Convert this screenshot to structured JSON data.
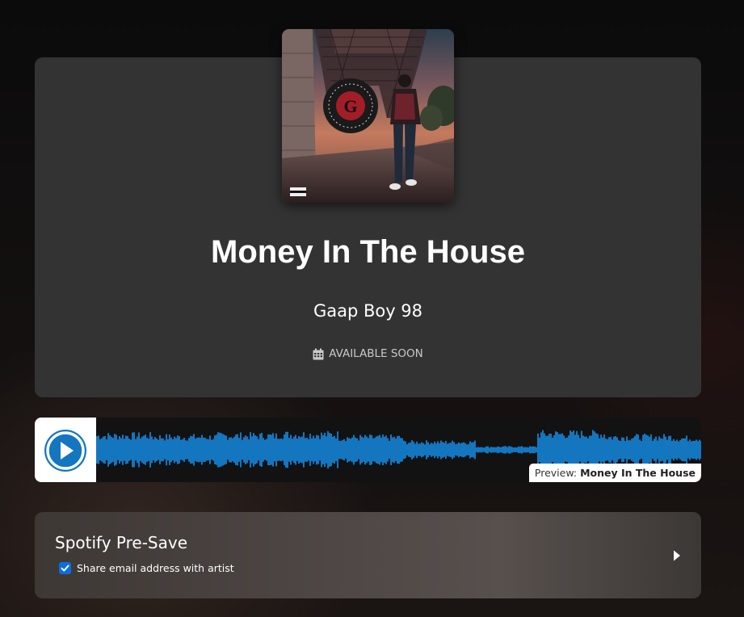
{
  "release": {
    "title": "Money In The House",
    "artist": "Gaap Boy 98",
    "availability": "AVAILABLE SOON",
    "availability_icon": "calendar-icon",
    "cover_badge_letter": "G"
  },
  "player": {
    "play_icon": "play-icon",
    "preview_prefix": "Preview:",
    "preview_title": "Money In The House",
    "accent_color": "#1476bf"
  },
  "presave": {
    "title": "Spotify Pre-Save",
    "share_label": "Share email address with artist",
    "share_checked": true,
    "arrow_icon": "caret-right-icon"
  }
}
